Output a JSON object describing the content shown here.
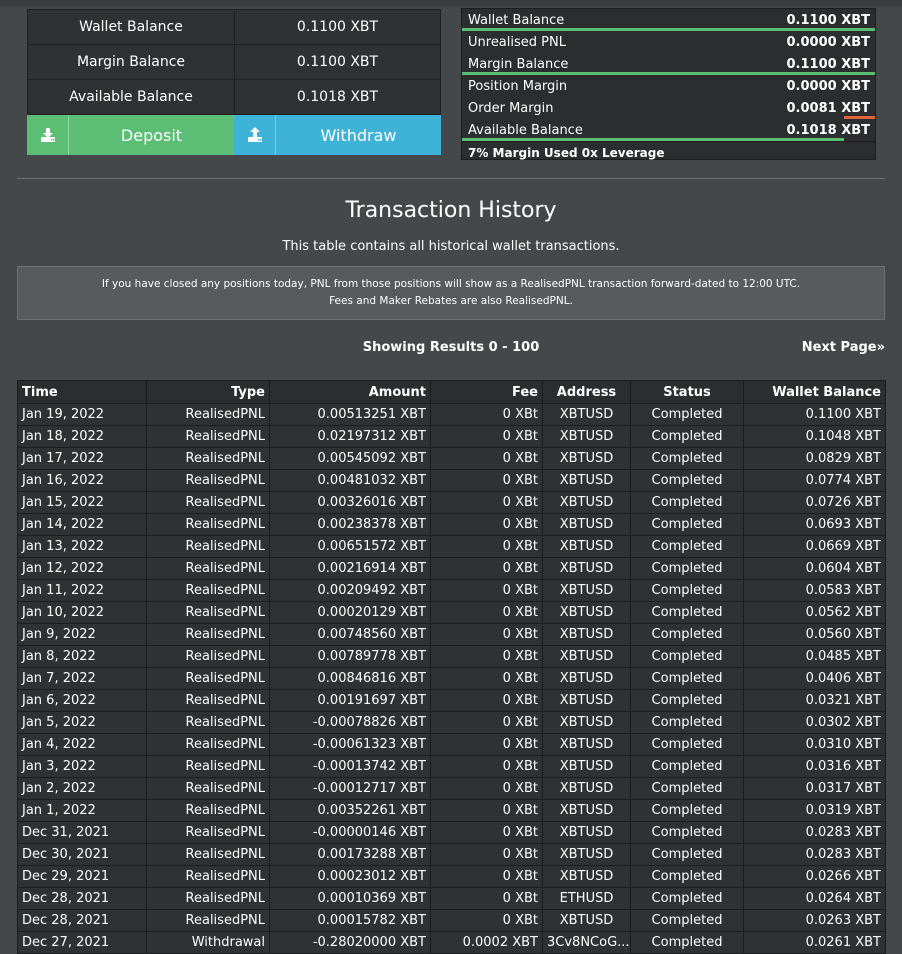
{
  "balances": {
    "rows": [
      {
        "label": "Wallet Balance",
        "value": "0.1100 XBT"
      },
      {
        "label": "Margin Balance",
        "value": "0.1100 XBT"
      },
      {
        "label": "Available Balance",
        "value": "0.1018 XBT"
      }
    ],
    "deposit_label": "Deposit",
    "withdraw_label": "Withdraw",
    "deposit_icon": "download-icon",
    "withdraw_icon": "upload-icon"
  },
  "margin_summary": {
    "rows": [
      {
        "label": "Wallet Balance",
        "value": "0.1100 XBT",
        "bar_fraction": 1.0,
        "bar_color": "#5cbe74"
      },
      {
        "label": "Unrealised PNL",
        "value": "0.0000 XBT",
        "bar_fraction": 0,
        "bar_color": ""
      },
      {
        "label": "Margin Balance",
        "value": "0.1100 XBT",
        "bar_fraction": 1.0,
        "bar_color": "#5cbe74"
      },
      {
        "label": "Position Margin",
        "value": "0.0000 XBT",
        "bar_fraction": 0,
        "bar_color": ""
      },
      {
        "label": "Order Margin",
        "value": "0.0081 XBT",
        "bar_fraction": 0.074,
        "bar_color": "#e0643a"
      },
      {
        "label": "Available Balance",
        "value": "0.1018 XBT",
        "bar_fraction": 0.926,
        "bar_color": "#5cbe74"
      }
    ],
    "footer": "7% Margin Used 0x Leverage"
  },
  "history": {
    "title": "Transaction History",
    "subtitle": "This table contains all historical wallet transactions.",
    "notice_line1": "If you have closed any positions today, PNL from those positions will show as a RealisedPNL transaction forward-dated to 12:00 UTC.",
    "notice_line2": "Fees and Maker Rebates are also RealisedPNL.",
    "results": "Showing Results 0 - 100",
    "next_page": "Next Page»",
    "columns": [
      "Time",
      "Type",
      "Amount",
      "Fee",
      "Address",
      "Status",
      "Wallet Balance"
    ],
    "rows": [
      [
        "Jan 19, 2022",
        "RealisedPNL",
        "0.00513251 XBT",
        "0 XBt",
        "XBTUSD",
        "Completed",
        "0.1100 XBT"
      ],
      [
        "Jan 18, 2022",
        "RealisedPNL",
        "0.02197312 XBT",
        "0 XBt",
        "XBTUSD",
        "Completed",
        "0.1048 XBT"
      ],
      [
        "Jan 17, 2022",
        "RealisedPNL",
        "0.00545092 XBT",
        "0 XBt",
        "XBTUSD",
        "Completed",
        "0.0829 XBT"
      ],
      [
        "Jan 16, 2022",
        "RealisedPNL",
        "0.00481032 XBT",
        "0 XBt",
        "XBTUSD",
        "Completed",
        "0.0774 XBT"
      ],
      [
        "Jan 15, 2022",
        "RealisedPNL",
        "0.00326016 XBT",
        "0 XBt",
        "XBTUSD",
        "Completed",
        "0.0726 XBT"
      ],
      [
        "Jan 14, 2022",
        "RealisedPNL",
        "0.00238378 XBT",
        "0 XBt",
        "XBTUSD",
        "Completed",
        "0.0693 XBT"
      ],
      [
        "Jan 13, 2022",
        "RealisedPNL",
        "0.00651572 XBT",
        "0 XBt",
        "XBTUSD",
        "Completed",
        "0.0669 XBT"
      ],
      [
        "Jan 12, 2022",
        "RealisedPNL",
        "0.00216914 XBT",
        "0 XBt",
        "XBTUSD",
        "Completed",
        "0.0604 XBT"
      ],
      [
        "Jan 11, 2022",
        "RealisedPNL",
        "0.00209492 XBT",
        "0 XBt",
        "XBTUSD",
        "Completed",
        "0.0583 XBT"
      ],
      [
        "Jan 10, 2022",
        "RealisedPNL",
        "0.00020129 XBT",
        "0 XBt",
        "XBTUSD",
        "Completed",
        "0.0562 XBT"
      ],
      [
        "Jan 9, 2022",
        "RealisedPNL",
        "0.00748560 XBT",
        "0 XBt",
        "XBTUSD",
        "Completed",
        "0.0560 XBT"
      ],
      [
        "Jan 8, 2022",
        "RealisedPNL",
        "0.00789778 XBT",
        "0 XBt",
        "XBTUSD",
        "Completed",
        "0.0485 XBT"
      ],
      [
        "Jan 7, 2022",
        "RealisedPNL",
        "0.00846816 XBT",
        "0 XBt",
        "XBTUSD",
        "Completed",
        "0.0406 XBT"
      ],
      [
        "Jan 6, 2022",
        "RealisedPNL",
        "0.00191697 XBT",
        "0 XBt",
        "XBTUSD",
        "Completed",
        "0.0321 XBT"
      ],
      [
        "Jan 5, 2022",
        "RealisedPNL",
        "-0.00078826 XBT",
        "0 XBt",
        "XBTUSD",
        "Completed",
        "0.0302 XBT"
      ],
      [
        "Jan 4, 2022",
        "RealisedPNL",
        "-0.00061323 XBT",
        "0 XBt",
        "XBTUSD",
        "Completed",
        "0.0310 XBT"
      ],
      [
        "Jan 3, 2022",
        "RealisedPNL",
        "-0.00013742 XBT",
        "0 XBt",
        "XBTUSD",
        "Completed",
        "0.0316 XBT"
      ],
      [
        "Jan 2, 2022",
        "RealisedPNL",
        "-0.00012717 XBT",
        "0 XBt",
        "XBTUSD",
        "Completed",
        "0.0317 XBT"
      ],
      [
        "Jan 1, 2022",
        "RealisedPNL",
        "0.00352261 XBT",
        "0 XBt",
        "XBTUSD",
        "Completed",
        "0.0319 XBT"
      ],
      [
        "Dec 31, 2021",
        "RealisedPNL",
        "-0.00000146 XBT",
        "0 XBt",
        "XBTUSD",
        "Completed",
        "0.0283 XBT"
      ],
      [
        "Dec 30, 2021",
        "RealisedPNL",
        "0.00173288 XBT",
        "0 XBt",
        "XBTUSD",
        "Completed",
        "0.0283 XBT"
      ],
      [
        "Dec 29, 2021",
        "RealisedPNL",
        "0.00023012 XBT",
        "0 XBt",
        "XBTUSD",
        "Completed",
        "0.0266 XBT"
      ],
      [
        "Dec 28, 2021",
        "RealisedPNL",
        "0.00010369 XBT",
        "0 XBt",
        "ETHUSD",
        "Completed",
        "0.0264 XBT"
      ],
      [
        "Dec 28, 2021",
        "RealisedPNL",
        "0.00015782 XBT",
        "0 XBt",
        "XBTUSD",
        "Completed",
        "0.0263 XBT"
      ],
      [
        "Dec 27, 2021",
        "Withdrawal",
        "-0.28020000 XBT",
        "0.0002 XBT",
        "3Cv8NCoG...",
        "Completed",
        "0.0261 XBT"
      ]
    ]
  }
}
